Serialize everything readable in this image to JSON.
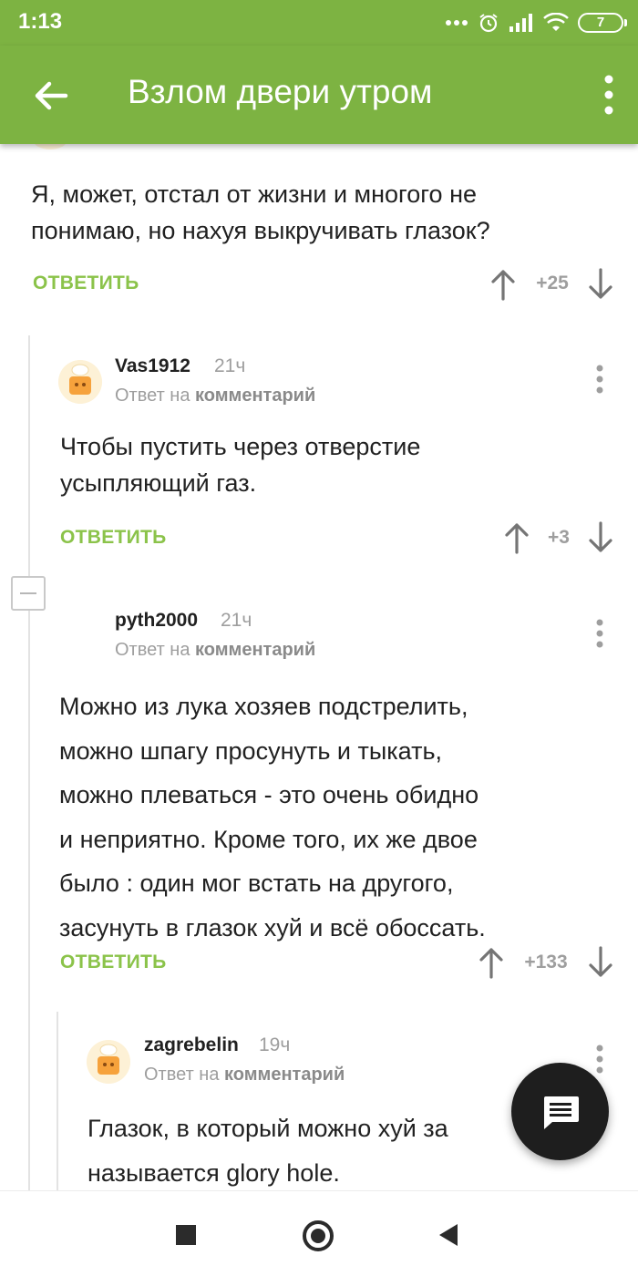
{
  "status_bar": {
    "time": "1:13",
    "battery": "7"
  },
  "app_bar": {
    "title": "Взлом двери утром"
  },
  "comments": [
    {
      "text_lines": [
        "Я, может, отстал от жизни и многого не",
        "понимаю, но нахуя выкручивать глазок?"
      ],
      "reply_label": "ОТВЕТИТЬ",
      "score": "+25"
    },
    {
      "author": "Vas1912",
      "time": "21ч",
      "reply_to_prefix": "Ответ на",
      "reply_to_link": "комментарий",
      "text_lines": [
        "Чтобы пустить через отверстие",
        "усыпляющий газ."
      ],
      "reply_label": "ОТВЕТИТЬ",
      "score": "+3"
    },
    {
      "author": "pyth2000",
      "time": "21ч",
      "reply_to_prefix": "Ответ на",
      "reply_to_link": "комментарий",
      "text_lines": [
        "Можно из лука хозяев подстрелить,",
        "можно шпагу просунуть и тыкать,",
        "можно плеваться - это очень обидно",
        "и неприятно. Кроме того, их же двое",
        "было : один мог встать на другого,",
        "засунуть в глазок хуй и всё обоссать."
      ],
      "reply_label": "ОТВЕТИТЬ",
      "score": "+133"
    },
    {
      "author": "zagrebelin",
      "time": "19ч",
      "reply_to_prefix": "Ответ на",
      "reply_to_link": "комментарий",
      "text_lines": [
        "Глазок, в который можно хуй за",
        "называется glory hole."
      ]
    }
  ],
  "icons": {
    "back": "arrow-back-icon",
    "menu": "more-vert-icon",
    "upvote": "arrow-up-icon",
    "downvote": "arrow-down-icon",
    "fab": "comment-icon"
  },
  "colors": {
    "brand_green": "#7db342",
    "reply_green": "#8bc34a",
    "muted_grey": "#9e9e9e",
    "fab_dark": "#1e1e1e"
  }
}
